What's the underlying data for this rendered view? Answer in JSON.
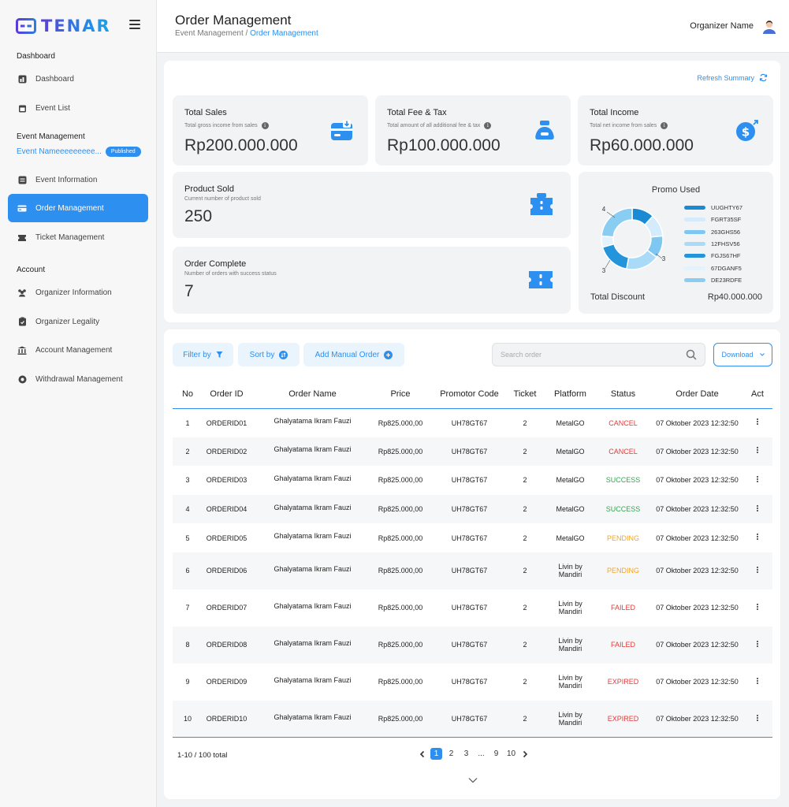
{
  "brand": {
    "name": "TENAR"
  },
  "sidebar": {
    "sections": {
      "dashboard": "Dashboard",
      "event_management": "Event Management",
      "account": "Account"
    },
    "items": [
      {
        "label": "Dashboard",
        "icon": "dashboard-icon"
      },
      {
        "label": "Event List",
        "icon": "calendar-icon"
      },
      {
        "label": "Event Information",
        "icon": "list-icon"
      },
      {
        "label": "Order Management",
        "icon": "card-icon"
      },
      {
        "label": "Ticket Management",
        "icon": "ticket-icon"
      },
      {
        "label": "Organizer Information",
        "icon": "users-icon"
      },
      {
        "label": "Organizer Legality",
        "icon": "clipboard-icon"
      },
      {
        "label": "Account Management",
        "icon": "bank-icon"
      },
      {
        "label": "Withdrawal Management",
        "icon": "coin-icon"
      }
    ],
    "event": {
      "name": "Event Nameeeeeeeee...",
      "badge": "Published"
    }
  },
  "header": {
    "title": "Order Management",
    "breadcrumb_parent": "Event Management",
    "breadcrumb_sep": " / ",
    "breadcrumb_current": "Order Management",
    "user": "Organizer Name"
  },
  "summary": {
    "refresh": "Refresh Summary",
    "total_sales": {
      "title": "Total Sales",
      "sub": "Total gross income from sales",
      "value": "Rp200.000.000"
    },
    "total_fee": {
      "title": "Total Fee & Tax",
      "sub": "Total amount of all additional fee & tax",
      "value": "Rp100.000.000"
    },
    "total_income": {
      "title": "Total Income",
      "sub": "Total net income from sales",
      "value": "Rp60.000.000"
    },
    "product_sold": {
      "title": "Product Sold",
      "sub": "Current number of product sold",
      "value": "250"
    },
    "order_complete": {
      "title": "Order Complete",
      "sub": "Number of orders with success status",
      "value": "7"
    },
    "promo": {
      "title": "Promo Used",
      "discount_label": "Total Discount",
      "discount_value": "Rp40.000.000"
    }
  },
  "chart_data": {
    "type": "pie",
    "title": "Promo Used",
    "categories": [
      "UUGHTY67",
      "FGRT35SF",
      "263GHS56",
      "12FHSV56",
      "FGJS67HF",
      "67DGANF5",
      "DE23RDFE"
    ],
    "values": [
      2,
      2,
      2,
      3,
      3,
      1,
      4
    ],
    "colors": [
      "#1a8ad4",
      "#d3ebfb",
      "#7ec7f2",
      "#a9dbf8",
      "#2494db",
      "#e3f2fc",
      "#8acdf3"
    ],
    "labels": {
      "left": "4",
      "right": "3",
      "bottom": "3"
    }
  },
  "toolbar": {
    "filter": "Filter by",
    "sort": "Sort by",
    "add": "Add Manual Order",
    "search_placeholder": "Search order",
    "download": "Download"
  },
  "table": {
    "headers": [
      "No",
      "Order ID",
      "Order Name",
      "Price",
      "Promotor Code",
      "Ticket",
      "Platform",
      "Status",
      "Order Date",
      "Act"
    ],
    "rows": [
      {
        "no": "1",
        "id": "ORDERID01",
        "name": "Ghalyatama Ikram Fauzi",
        "price": "Rp825.000,00",
        "code": "UH78GT67",
        "ticket": "2",
        "platform": "MetalGO",
        "status": "CANCEL",
        "date": "07 Oktober 2023 12:32:50"
      },
      {
        "no": "2",
        "id": "ORDERID02",
        "name": "Ghalyatama Ikram Fauzi",
        "price": "Rp825.000,00",
        "code": "UH78GT67",
        "ticket": "2",
        "platform": "MetalGO",
        "status": "CANCEL",
        "date": "07 Oktober 2023 12:32:50"
      },
      {
        "no": "3",
        "id": "ORDERID03",
        "name": "Ghalyatama Ikram Fauzi",
        "price": "Rp825.000,00",
        "code": "UH78GT67",
        "ticket": "2",
        "platform": "MetalGO",
        "status": "SUCCESS",
        "date": "07 Oktober 2023 12:32:50"
      },
      {
        "no": "4",
        "id": "ORDERID04",
        "name": "Ghalyatama Ikram Fauzi",
        "price": "Rp825.000,00",
        "code": "UH78GT67",
        "ticket": "2",
        "platform": "MetalGO",
        "status": "SUCCESS",
        "date": "07 Oktober 2023 12:32:50"
      },
      {
        "no": "5",
        "id": "ORDERID05",
        "name": "Ghalyatama Ikram Fauzi",
        "price": "Rp825.000,00",
        "code": "UH78GT67",
        "ticket": "2",
        "platform": "MetalGO",
        "status": "PENDING",
        "date": "07 Oktober 2023 12:32:50"
      },
      {
        "no": "6",
        "id": "ORDERID06",
        "name": "Ghalyatama Ikram Fauzi",
        "price": "Rp825.000,00",
        "code": "UH78GT67",
        "ticket": "2",
        "platform": "Livin by Mandiri",
        "status": "PENDING",
        "date": "07 Oktober 2023 12:32:50"
      },
      {
        "no": "7",
        "id": "ORDERID07",
        "name": "Ghalyatama Ikram Fauzi",
        "price": "Rp825.000,00",
        "code": "UH78GT67",
        "ticket": "2",
        "platform": "Livin by Mandiri",
        "status": "FAILED",
        "date": "07 Oktober 2023 12:32:50"
      },
      {
        "no": "8",
        "id": "ORDERID08",
        "name": "Ghalyatama Ikram Fauzi",
        "price": "Rp825.000,00",
        "code": "UH78GT67",
        "ticket": "2",
        "platform": "Livin by Mandiri",
        "status": "FAILED",
        "date": "07 Oktober 2023 12:32:50"
      },
      {
        "no": "9",
        "id": "ORDERID09",
        "name": "Ghalyatama Ikram Fauzi",
        "price": "Rp825.000,00",
        "code": "UH78GT67",
        "ticket": "2",
        "platform": "Livin by Mandiri",
        "status": "EXPIRED",
        "date": "07 Oktober 2023 12:32:50"
      },
      {
        "no": "10",
        "id": "ORDERID10",
        "name": "Ghalyatama Ikram Fauzi",
        "price": "Rp825.000,00",
        "code": "UH78GT67",
        "ticket": "2",
        "platform": "Livin by Mandiri",
        "status": "EXPIRED",
        "date": "07 Oktober 2023 12:32:50"
      }
    ]
  },
  "pagination": {
    "total": "1-10 / 100 total",
    "pages": [
      "1",
      "2",
      "3",
      "...",
      "9",
      "10"
    ],
    "current": "1"
  },
  "colors": {
    "accent": "#2d8ff0",
    "cancel": "#e33b3b",
    "success": "#2fa84f",
    "pending": "#f5a623"
  }
}
